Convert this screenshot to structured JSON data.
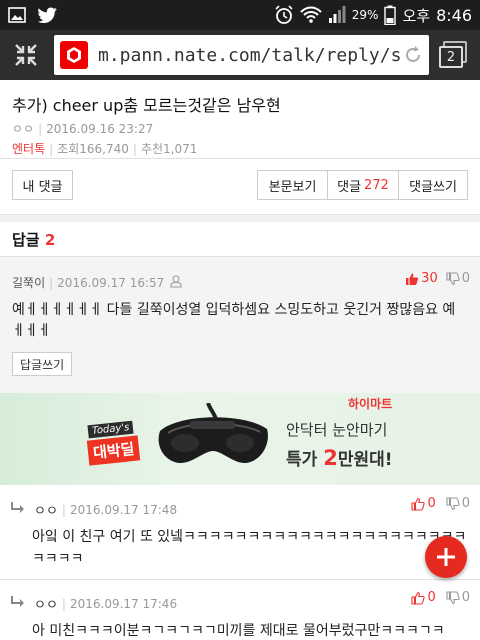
{
  "status_bar": {
    "battery": "29%",
    "ampm": "오후",
    "time": "8:46"
  },
  "browser": {
    "url": "m.pann.nate.com/talk/reply/subR",
    "tab_count": "2"
  },
  "article": {
    "title": "추가) cheer up춤 모르는것같은 남우현",
    "author": "ㅇㅇ",
    "date": "2016.09.16 23:27",
    "category": "엔터톡",
    "views": "조회166,740",
    "likes": "추천1,071"
  },
  "buttons": {
    "my_comments": "내 댓글",
    "view_post": "본문보기",
    "comments_label": "댓글",
    "comments_count": "272",
    "write_comment": "댓글쓰기"
  },
  "replies": {
    "label": "답글",
    "count": "2"
  },
  "parent_comment": {
    "author": "길쭉이",
    "date": "2016.09.17 16:57",
    "up": "30",
    "down": "0",
    "text": "예ㅔㅔㅔㅔㅔㅔ 다들 길쭉이성열 입덕하셈요 스밍도하고 웃긴거 짱많음요 예ㅔㅔㅔ",
    "reply_button": "답글쓰기"
  },
  "ad": {
    "badge_top": "Today's",
    "badge_main": "대박딜",
    "brand": "하이마트",
    "line1": "안닥터 눈안마기",
    "line2_prefix": "특가",
    "line2_big": "2",
    "line2_suffix": "만원대!"
  },
  "sub_replies": [
    {
      "author": "ㅇㅇ",
      "date": "2016.09.17 17:48",
      "up": "0",
      "down": "0",
      "text": "아잌 이 친구 여기 또 있넼ㅋㅋㅋㅋㅋㅋㅋㅋㅋㅋㅋㅋㅋㅋㅋㅋㅋㅋㅋㅋㅋㅋㅋㅋㅋㅋ"
    },
    {
      "author": "ㅇㅇ",
      "date": "2016.09.17 17:46",
      "up": "0",
      "down": "0",
      "text": "아 미친ㅋㅋㅋ이분ㅋㄱㅋㄱㅋㄱ미끼를 제대로 물어부렀구만ㅋㅋㅋㄱㅋ"
    }
  ],
  "colors": {
    "accent": "#e33333",
    "fab": "#e52a1f"
  },
  "icons": {
    "fab": "plus-icon",
    "collapse": "collapse-arrows-icon"
  }
}
